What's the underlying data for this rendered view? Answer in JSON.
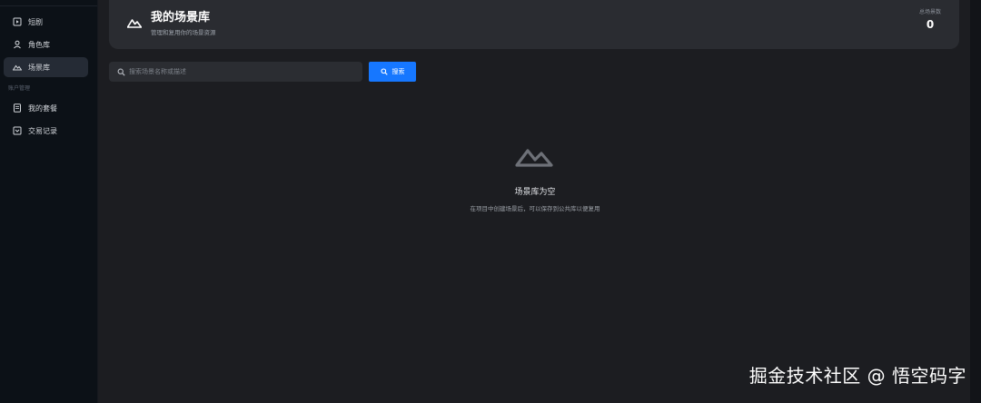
{
  "sidebar": {
    "items": [
      {
        "label": "短剧",
        "icon": "film-icon"
      },
      {
        "label": "角色库",
        "icon": "user-icon"
      },
      {
        "label": "场景库",
        "icon": "mountain-icon",
        "active": true
      },
      {
        "label": "我的套餐",
        "icon": "document-icon"
      },
      {
        "label": "交易记录",
        "icon": "transaction-icon"
      }
    ],
    "section_label": "账户管理"
  },
  "header": {
    "title": "我的场景库",
    "subtitle": "管理和复用你的场景资源",
    "stat_label": "总场景数",
    "stat_value": "0"
  },
  "search": {
    "placeholder": "搜索场景名称或描述",
    "value": "",
    "button_label": "搜索"
  },
  "empty_state": {
    "title": "场景库为空",
    "description": "在项目中创建场景后，可以保存到公共库以便复用"
  },
  "watermark": "掘金技术社区 @ 悟空码字",
  "colors": {
    "accent": "#1677ff",
    "background": "#1c1d21",
    "sidebar": "#0c1117"
  }
}
